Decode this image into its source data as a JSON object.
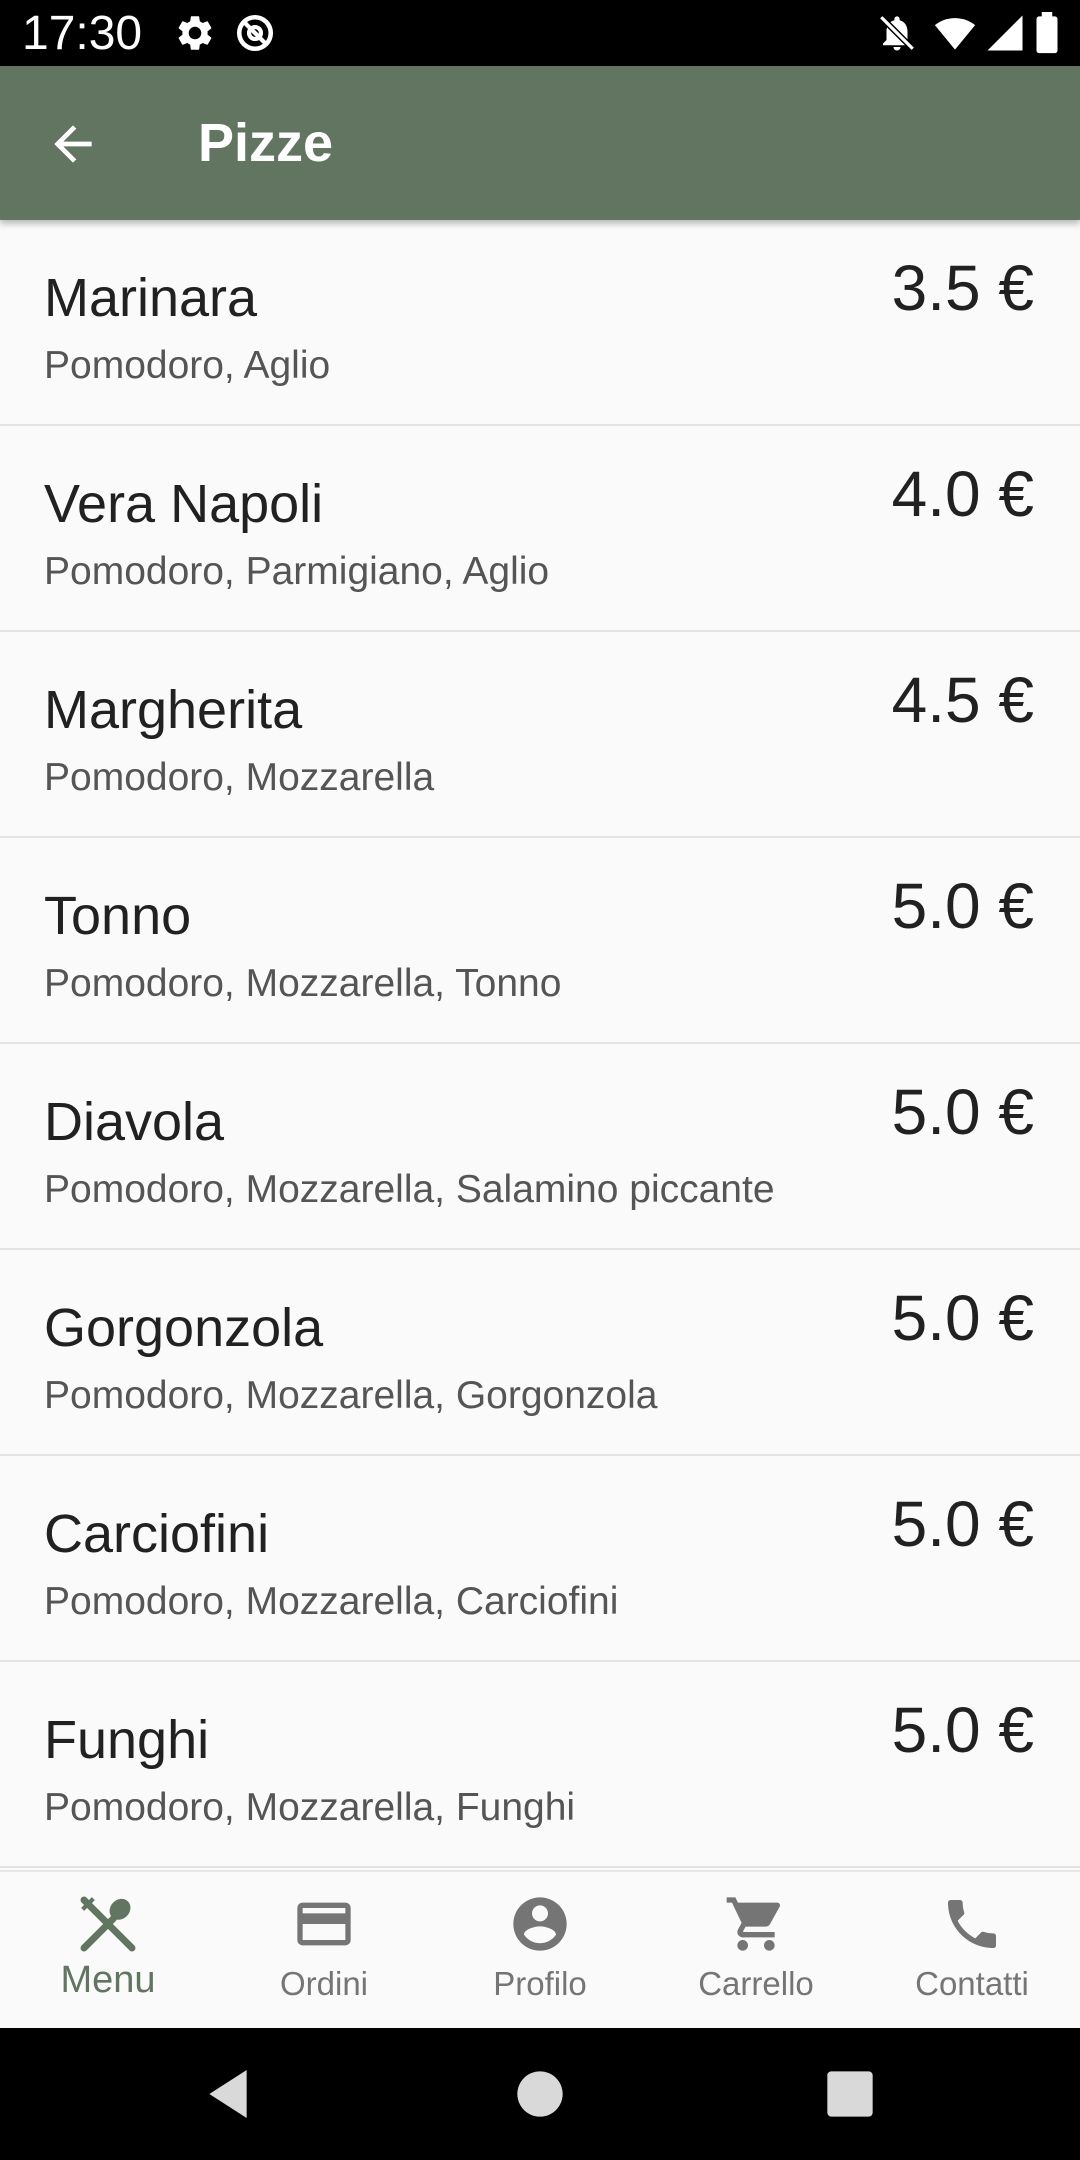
{
  "status_bar": {
    "time": "17:30",
    "icons_left": [
      "gear-icon",
      "at-sign-icon"
    ],
    "icons_right": [
      "notifications-off-icon",
      "wifi-icon",
      "signal-icon",
      "battery-icon"
    ]
  },
  "app_bar": {
    "title": "Pizze",
    "background": "#627561",
    "back_icon": "arrow-back-icon"
  },
  "menu_items": [
    {
      "name": "Marinara",
      "ingredients": "Pomodoro, Aglio",
      "price": "3.5 €"
    },
    {
      "name": "Vera Napoli",
      "ingredients": "Pomodoro, Parmigiano, Aglio",
      "price": "4.0 €"
    },
    {
      "name": "Margherita",
      "ingredients": "Pomodoro, Mozzarella",
      "price": "4.5 €"
    },
    {
      "name": "Tonno",
      "ingredients": "Pomodoro, Mozzarella, Tonno",
      "price": "5.0 €"
    },
    {
      "name": "Diavola",
      "ingredients": "Pomodoro, Mozzarella, Salamino piccante",
      "price": "5.0 €"
    },
    {
      "name": "Gorgonzola",
      "ingredients": "Pomodoro, Mozzarella, Gorgonzola",
      "price": "5.0 €"
    },
    {
      "name": "Carciofini",
      "ingredients": "Pomodoro, Mozzarella, Carciofini",
      "price": "5.0 €"
    },
    {
      "name": "Funghi",
      "ingredients": "Pomodoro, Mozzarella, Funghi",
      "price": "5.0 €"
    }
  ],
  "bottom_nav": {
    "active_color": "#627561",
    "inactive_color": "#757575",
    "items": [
      {
        "label": "Menu",
        "icon": "fork-spoon-icon",
        "active": true
      },
      {
        "label": "Ordini",
        "icon": "credit-card-icon",
        "active": false
      },
      {
        "label": "Profilo",
        "icon": "account-circle-icon",
        "active": false
      },
      {
        "label": "Carrello",
        "icon": "shopping-cart-icon",
        "active": false
      },
      {
        "label": "Contatti",
        "icon": "phone-icon",
        "active": false
      }
    ]
  },
  "system_nav": {
    "icons": [
      "back-triangle-icon",
      "home-circle-icon",
      "recents-square-icon"
    ]
  }
}
